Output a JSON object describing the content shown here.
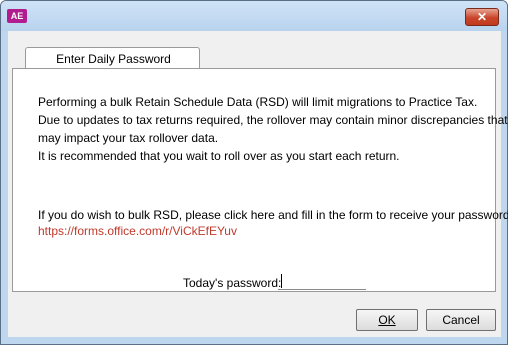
{
  "window": {
    "logo_text": "AE",
    "close_label": "✕"
  },
  "tab": {
    "label": "Enter Daily Password"
  },
  "message": {
    "lines": [
      "Performing a bulk Retain Schedule Data (RSD) will limit migrations to Practice Tax.",
      "Due to updates to tax returns required, the rollover may contain minor discrepancies that",
      "may impact your tax rollover data.",
      "It is recommended that you wait to roll over as you start each return."
    ],
    "instruction": "If you do wish to bulk RSD, please click here and fill in the form to receive your passwords:",
    "link": "https://forms.office.com/r/ViCkEfEYuv"
  },
  "password": {
    "label": "Today's password:",
    "value": ""
  },
  "buttons": {
    "ok": "OK",
    "cancel": "Cancel"
  },
  "colors": {
    "link": "#c0392b",
    "logo": "#b11c8e",
    "close": "#c9452a"
  }
}
